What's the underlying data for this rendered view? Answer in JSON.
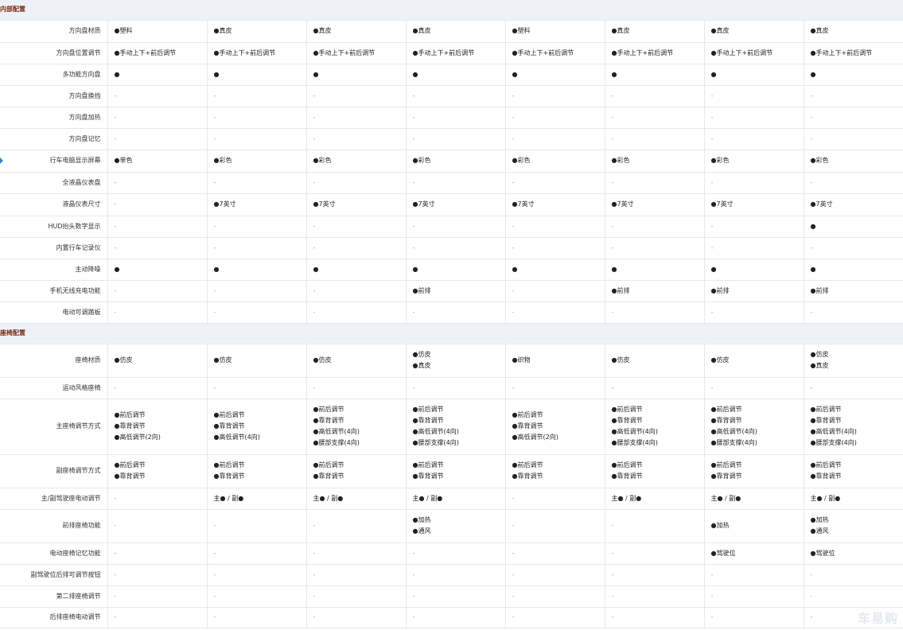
{
  "sections": [
    {
      "title": "内部配置",
      "rows": [
        {
          "label": "方向盘材质",
          "values": [
            [
              "●塑料"
            ],
            [
              "●真皮"
            ],
            [
              "●真皮"
            ],
            [
              "●真皮"
            ],
            [
              "●塑料"
            ],
            [
              "●真皮"
            ],
            [
              "●真皮"
            ],
            [
              "●真皮"
            ]
          ]
        },
        {
          "label": "方向盘位置调节",
          "values": [
            [
              "●手动上下+前后调节"
            ],
            [
              "●手动上下+前后调节"
            ],
            [
              "●手动上下+前后调节"
            ],
            [
              "●手动上下+前后调节"
            ],
            [
              "●手动上下+前后调节"
            ],
            [
              "●手动上下+前后调节"
            ],
            [
              "●手动上下+前后调节"
            ],
            [
              "●手动上下+前后调节"
            ]
          ]
        },
        {
          "label": "多功能方向盘",
          "values": [
            [
              "●"
            ],
            [
              "●"
            ],
            [
              "●"
            ],
            [
              "●"
            ],
            [
              "●"
            ],
            [
              "●"
            ],
            [
              "●"
            ],
            [
              "●"
            ]
          ]
        },
        {
          "label": "方向盘换挡",
          "values": [
            [
              "-"
            ],
            [
              "-"
            ],
            [
              "-"
            ],
            [
              "-"
            ],
            [
              "-"
            ],
            [
              "-"
            ],
            [
              "-"
            ],
            [
              "-"
            ]
          ]
        },
        {
          "label": "方向盘加热",
          "values": [
            [
              "-"
            ],
            [
              "-"
            ],
            [
              "-"
            ],
            [
              "-"
            ],
            [
              "-"
            ],
            [
              "-"
            ],
            [
              "-"
            ],
            [
              "-"
            ]
          ]
        },
        {
          "label": "方向盘记忆",
          "values": [
            [
              "-"
            ],
            [
              "-"
            ],
            [
              "-"
            ],
            [
              "-"
            ],
            [
              "-"
            ],
            [
              "-"
            ],
            [
              "-"
            ],
            [
              "-"
            ]
          ]
        },
        {
          "label": "行车电脑显示屏幕",
          "values": [
            [
              "●单色"
            ],
            [
              "●彩色"
            ],
            [
              "●彩色"
            ],
            [
              "●彩色"
            ],
            [
              "●彩色"
            ],
            [
              "●彩色"
            ],
            [
              "●彩色"
            ],
            [
              "●彩色"
            ]
          ]
        },
        {
          "label": "全液晶仪表盘",
          "values": [
            [
              "-"
            ],
            [
              "-"
            ],
            [
              "-"
            ],
            [
              "-"
            ],
            [
              "-"
            ],
            [
              "-"
            ],
            [
              "-"
            ],
            [
              "-"
            ]
          ]
        },
        {
          "label": "液晶仪表尺寸",
          "values": [
            [
              "-"
            ],
            [
              "●7英寸"
            ],
            [
              "●7英寸"
            ],
            [
              "●7英寸"
            ],
            [
              "●7英寸"
            ],
            [
              "●7英寸"
            ],
            [
              "●7英寸"
            ],
            [
              "●7英寸"
            ]
          ]
        },
        {
          "label": "HUD抬头数字显示",
          "values": [
            [
              "-"
            ],
            [
              "-"
            ],
            [
              "-"
            ],
            [
              "-"
            ],
            [
              "-"
            ],
            [
              "-"
            ],
            [
              "-"
            ],
            [
              "●"
            ]
          ]
        },
        {
          "label": "内置行车记录仪",
          "values": [
            [
              "-"
            ],
            [
              "-"
            ],
            [
              "-"
            ],
            [
              "-"
            ],
            [
              "-"
            ],
            [
              "-"
            ],
            [
              "-"
            ],
            [
              "-"
            ]
          ]
        },
        {
          "label": "主动降噪",
          "values": [
            [
              "●"
            ],
            [
              "●"
            ],
            [
              "●"
            ],
            [
              "●"
            ],
            [
              "●"
            ],
            [
              "●"
            ],
            [
              "●"
            ],
            [
              "●"
            ]
          ]
        },
        {
          "label": "手机无线充电功能",
          "values": [
            [
              "-"
            ],
            [
              "-"
            ],
            [
              "-"
            ],
            [
              "●前排"
            ],
            [
              "-"
            ],
            [
              "●前排"
            ],
            [
              "●前排"
            ],
            [
              "●前排"
            ]
          ]
        },
        {
          "label": "电动可调踏板",
          "values": [
            [
              "-"
            ],
            [
              "-"
            ],
            [
              "-"
            ],
            [
              "-"
            ],
            [
              "-"
            ],
            [
              "-"
            ],
            [
              "-"
            ],
            [
              "-"
            ]
          ]
        }
      ]
    },
    {
      "title": "座椅配置",
      "rows": [
        {
          "label": "座椅材质",
          "values": [
            [
              "●仿皮"
            ],
            [
              "●仿皮"
            ],
            [
              "●仿皮"
            ],
            [
              "●仿皮",
              "●真皮"
            ],
            [
              "●织物"
            ],
            [
              "●仿皮"
            ],
            [
              "●仿皮"
            ],
            [
              "●仿皮",
              "●真皮"
            ]
          ]
        },
        {
          "label": "运动风格座椅",
          "values": [
            [
              "-"
            ],
            [
              "-"
            ],
            [
              "-"
            ],
            [
              "-"
            ],
            [
              "-"
            ],
            [
              "-"
            ],
            [
              "-"
            ],
            [
              "-"
            ]
          ]
        },
        {
          "label": "主座椅调节方式",
          "values": [
            [
              "●前后调节",
              "●靠背调节",
              "●高低调节(2向)"
            ],
            [
              "●前后调节",
              "●靠背调节",
              "●高低调节(4向)"
            ],
            [
              "●前后调节",
              "●靠背调节",
              "●高低调节(4向)",
              "●腰部支撑(4向)"
            ],
            [
              "●前后调节",
              "●靠背调节",
              "●高低调节(4向)",
              "●腰部支撑(4向)"
            ],
            [
              "●前后调节",
              "●靠背调节",
              "●高低调节(2向)"
            ],
            [
              "●前后调节",
              "●靠背调节",
              "●高低调节(4向)",
              "●腰部支撑(4向)"
            ],
            [
              "●前后调节",
              "●靠背调节",
              "●高低调节(4向)",
              "●腰部支撑(4向)"
            ],
            [
              "●前后调节",
              "●靠背调节",
              "●高低调节(4向)",
              "●腰部支撑(4向)"
            ]
          ]
        },
        {
          "label": "副座椅调节方式",
          "values": [
            [
              "●前后调节",
              "●靠背调节"
            ],
            [
              "●前后调节",
              "●靠背调节"
            ],
            [
              "●前后调节",
              "●靠背调节"
            ],
            [
              "●前后调节",
              "●靠背调节"
            ],
            [
              "●前后调节",
              "●靠背调节"
            ],
            [
              "●前后调节",
              "●靠背调节"
            ],
            [
              "●前后调节",
              "●靠背调节"
            ],
            [
              "●前后调节",
              "●靠背调节"
            ]
          ]
        },
        {
          "label": "主/副驾驶座电动调节",
          "values": [
            [
              "-"
            ],
            [
              "主● / 副●"
            ],
            [
              "主● / 副●"
            ],
            [
              "主● / 副●"
            ],
            [
              "-"
            ],
            [
              "主● / 副●"
            ],
            [
              "主● / 副●"
            ],
            [
              "主● / 副●"
            ]
          ]
        },
        {
          "label": "前排座椅功能",
          "values": [
            [
              "-"
            ],
            [
              "-"
            ],
            [
              "-"
            ],
            [
              "●加热",
              "●通风"
            ],
            [
              "-"
            ],
            [
              "-"
            ],
            [
              "●加热"
            ],
            [
              "●加热",
              "●通风"
            ]
          ]
        },
        {
          "label": "电动座椅记忆功能",
          "values": [
            [
              "-"
            ],
            [
              "-"
            ],
            [
              "-"
            ],
            [
              "-"
            ],
            [
              "-"
            ],
            [
              "-"
            ],
            [
              "●驾驶位"
            ],
            [
              "●驾驶位"
            ]
          ]
        },
        {
          "label": "副驾驶位后排可调节按钮",
          "values": [
            [
              "-"
            ],
            [
              "-"
            ],
            [
              "-"
            ],
            [
              "-"
            ],
            [
              "-"
            ],
            [
              "-"
            ],
            [
              "-"
            ],
            [
              "-"
            ]
          ]
        },
        {
          "label": "第二排座椅调节",
          "values": [
            [
              "-"
            ],
            [
              "-"
            ],
            [
              "-"
            ],
            [
              "-"
            ],
            [
              "-"
            ],
            [
              "-"
            ],
            [
              "-"
            ],
            [
              "-"
            ]
          ]
        },
        {
          "label": "后排座椅电动调节",
          "values": [
            [
              "-"
            ],
            [
              "-"
            ],
            [
              "-"
            ],
            [
              "-"
            ],
            [
              "-"
            ],
            [
              "-"
            ],
            [
              "-"
            ],
            [
              "-"
            ]
          ]
        }
      ]
    }
  ],
  "watermark": "车易购"
}
